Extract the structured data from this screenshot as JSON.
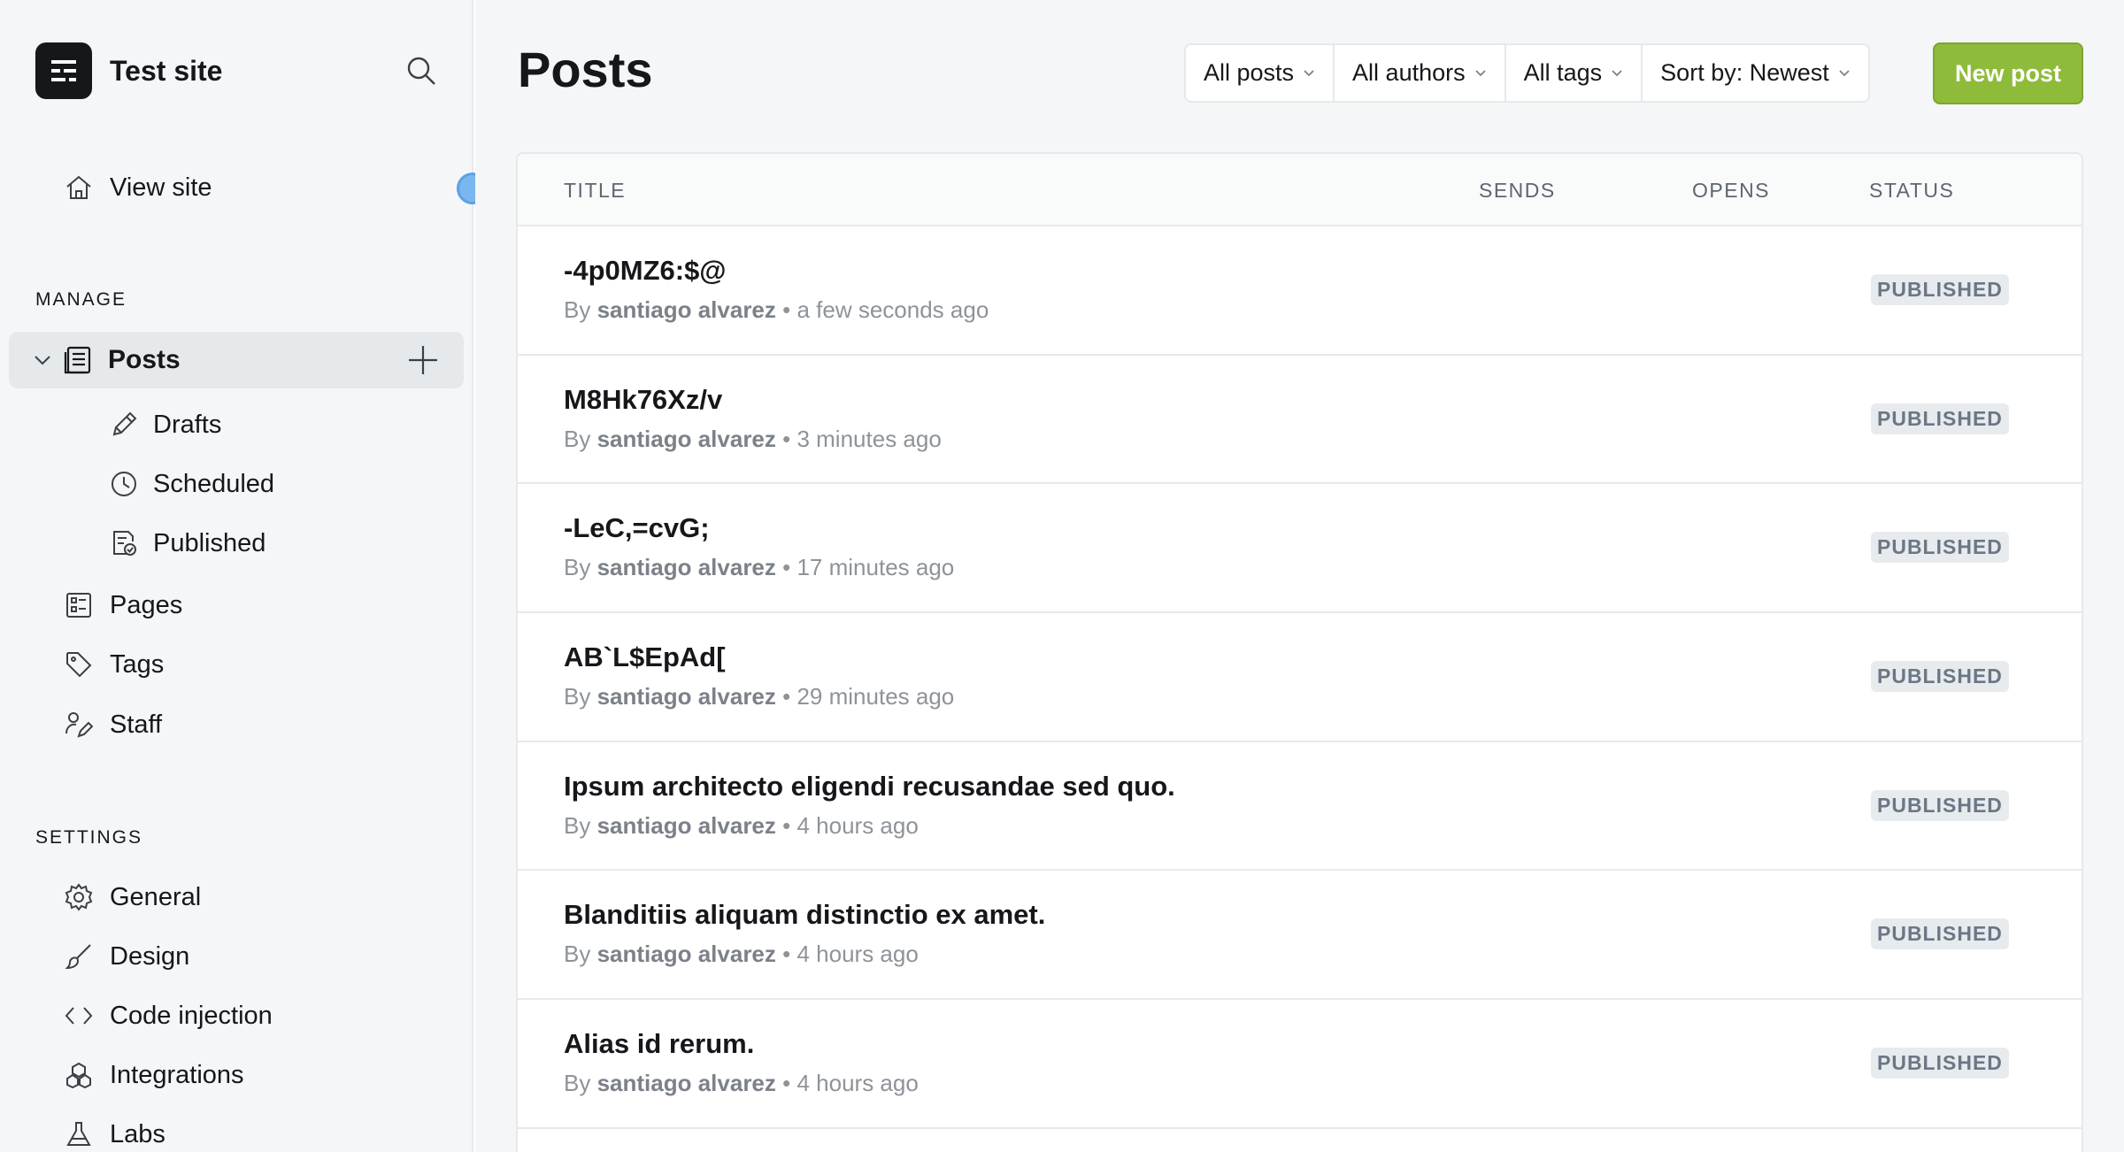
{
  "site": {
    "title": "Test site"
  },
  "sidebar": {
    "view_site": "View site",
    "manage_title": "MANAGE",
    "posts_label": "Posts",
    "sub_items": [
      {
        "label": "Drafts",
        "icon": "pencil-icon"
      },
      {
        "label": "Scheduled",
        "icon": "clock-icon"
      },
      {
        "label": "Published",
        "icon": "published-doc-icon"
      }
    ],
    "manage_items": [
      {
        "label": "Pages",
        "icon": "pages-icon"
      },
      {
        "label": "Tags",
        "icon": "tag-icon"
      },
      {
        "label": "Staff",
        "icon": "staff-icon"
      }
    ],
    "settings_title": "SETTINGS",
    "settings_items": [
      {
        "label": "General",
        "icon": "gear-icon"
      },
      {
        "label": "Design",
        "icon": "brush-icon"
      },
      {
        "label": "Code injection",
        "icon": "code-icon"
      },
      {
        "label": "Integrations",
        "icon": "cubes-icon"
      },
      {
        "label": "Labs",
        "icon": "flask-icon"
      }
    ]
  },
  "header": {
    "title": "Posts",
    "filters": [
      "All posts",
      "All authors",
      "All tags",
      "Sort by: Newest"
    ],
    "new_post": "New post"
  },
  "table": {
    "columns": [
      "TITLE",
      "SENDS",
      "OPENS",
      "STATUS"
    ],
    "rows": [
      {
        "title": "-4p0MZ6:$@",
        "by": "By",
        "author": "santiago alvarez",
        "sep": "•",
        "time": "a few seconds ago",
        "status": "PUBLISHED"
      },
      {
        "title": "M8Hk76Xz/v",
        "by": "By",
        "author": "santiago alvarez",
        "sep": "•",
        "time": "3 minutes ago",
        "status": "PUBLISHED"
      },
      {
        "title": "-LeC,=cvG;",
        "by": "By",
        "author": "santiago alvarez",
        "sep": "•",
        "time": "17 minutes ago",
        "status": "PUBLISHED"
      },
      {
        "title": "AB`L$EpAd[",
        "by": "By",
        "author": "santiago alvarez",
        "sep": "•",
        "time": "29 minutes ago",
        "status": "PUBLISHED"
      },
      {
        "title": "Ipsum architecto eligendi recusandae sed quo.",
        "by": "By",
        "author": "santiago alvarez",
        "sep": "•",
        "time": "4 hours ago",
        "status": "PUBLISHED"
      },
      {
        "title": "Blanditiis aliquam distinctio ex amet.",
        "by": "By",
        "author": "santiago alvarez",
        "sep": "•",
        "time": "4 hours ago",
        "status": "PUBLISHED"
      },
      {
        "title": "Alias id rerum.",
        "by": "By",
        "author": "santiago alvarez",
        "sep": "•",
        "time": "4 hours ago",
        "status": "PUBLISHED"
      }
    ]
  },
  "colors": {
    "accent_green": "#8fbb3a",
    "toggle_blue": "#7ab7ee",
    "sidebar_bg": "#f5f6f7"
  }
}
